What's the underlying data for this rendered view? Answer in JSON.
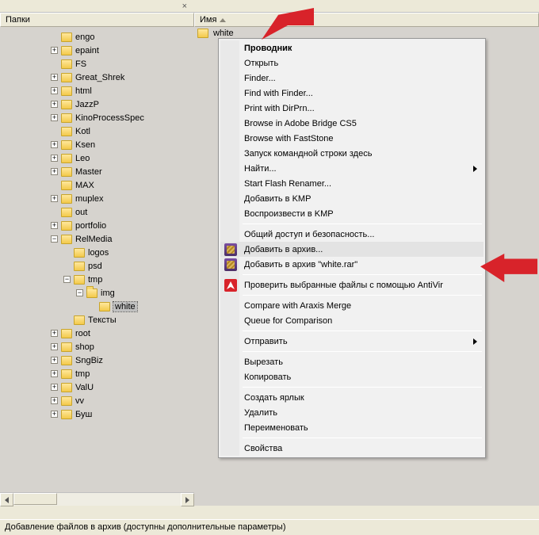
{
  "headers": {
    "left": "Папки",
    "right": "Имя"
  },
  "tree": [
    {
      "level": 4,
      "expander": "",
      "label": "engo"
    },
    {
      "level": 4,
      "expander": "+",
      "label": "epaint"
    },
    {
      "level": 4,
      "expander": "",
      "label": "FS"
    },
    {
      "level": 4,
      "expander": "+",
      "label": "Great_Shrek"
    },
    {
      "level": 4,
      "expander": "+",
      "label": "html"
    },
    {
      "level": 4,
      "expander": "+",
      "label": "JazzP"
    },
    {
      "level": 4,
      "expander": "+",
      "label": "KinoProcessSpec"
    },
    {
      "level": 4,
      "expander": "",
      "label": "Kotl"
    },
    {
      "level": 4,
      "expander": "+",
      "label": "Ksen"
    },
    {
      "level": 4,
      "expander": "+",
      "label": "Leo"
    },
    {
      "level": 4,
      "expander": "+",
      "label": "Master"
    },
    {
      "level": 4,
      "expander": "",
      "label": "MAX"
    },
    {
      "level": 4,
      "expander": "+",
      "label": "muplex"
    },
    {
      "level": 4,
      "expander": "",
      "label": "out"
    },
    {
      "level": 4,
      "expander": "+",
      "label": "portfolio"
    },
    {
      "level": 4,
      "expander": "-",
      "label": "RelMedia"
    },
    {
      "level": 5,
      "expander": "",
      "label": "logos"
    },
    {
      "level": 5,
      "expander": "",
      "label": "psd"
    },
    {
      "level": 5,
      "expander": "-",
      "label": "tmp"
    },
    {
      "level": 6,
      "expander": "-",
      "label": "img",
      "open": true
    },
    {
      "level": 7,
      "expander": "",
      "label": "white",
      "selected": true
    },
    {
      "level": 5,
      "expander": "",
      "label": "Тексты"
    },
    {
      "level": 4,
      "expander": "+",
      "label": "root"
    },
    {
      "level": 4,
      "expander": "+",
      "label": "shop"
    },
    {
      "level": 4,
      "expander": "+",
      "label": "SngBiz"
    },
    {
      "level": 4,
      "expander": "+",
      "label": "tmp"
    },
    {
      "level": 4,
      "expander": "+",
      "label": "ValU"
    },
    {
      "level": 4,
      "expander": "+",
      "label": "vv"
    },
    {
      "level": 4,
      "expander": "+",
      "label": "Буш"
    }
  ],
  "file_list": {
    "item": "white"
  },
  "context_menu": [
    {
      "type": "item",
      "label": "Проводник",
      "default": true
    },
    {
      "type": "item",
      "label": "Открыть"
    },
    {
      "type": "item",
      "label": "Finder..."
    },
    {
      "type": "item",
      "label": "Find with Finder..."
    },
    {
      "type": "item",
      "label": "Print with DirPrn..."
    },
    {
      "type": "item",
      "label": "Browse in Adobe Bridge CS5"
    },
    {
      "type": "item",
      "label": "Browse with FastStone"
    },
    {
      "type": "item",
      "label": "Запуск командной строки здесь"
    },
    {
      "type": "item",
      "label": "Найти...",
      "submenu": true
    },
    {
      "type": "item",
      "label": "Start Flash Renamer..."
    },
    {
      "type": "item",
      "label": "Добавить в KMP"
    },
    {
      "type": "item",
      "label": "Воспроизвести в KMP"
    },
    {
      "type": "sep"
    },
    {
      "type": "item",
      "label": "Общий доступ и безопасность..."
    },
    {
      "type": "item",
      "label": "Добавить в архив...",
      "icon": "rar",
      "hover": true
    },
    {
      "type": "item",
      "label": "Добавить в архив \"white.rar\"",
      "icon": "rar"
    },
    {
      "type": "sep"
    },
    {
      "type": "item",
      "label": "Проверить выбранные файлы с помощью AntiVir",
      "icon": "av"
    },
    {
      "type": "sep"
    },
    {
      "type": "item",
      "label": "Compare with Araxis Merge"
    },
    {
      "type": "item",
      "label": "Queue for Comparison"
    },
    {
      "type": "sep"
    },
    {
      "type": "item",
      "label": "Отправить",
      "submenu": true
    },
    {
      "type": "sep"
    },
    {
      "type": "item",
      "label": "Вырезать"
    },
    {
      "type": "item",
      "label": "Копировать"
    },
    {
      "type": "sep"
    },
    {
      "type": "item",
      "label": "Создать ярлык"
    },
    {
      "type": "item",
      "label": "Удалить"
    },
    {
      "type": "item",
      "label": "Переименовать"
    },
    {
      "type": "sep"
    },
    {
      "type": "item",
      "label": "Свойства"
    }
  ],
  "statusbar": "Добавление файлов в архив (доступны дополнительные параметры)",
  "close_x": "×"
}
